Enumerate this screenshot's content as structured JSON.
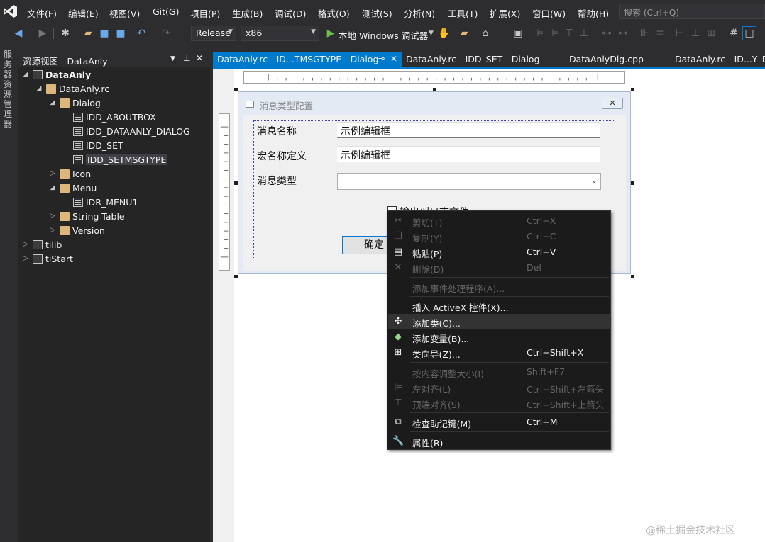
{
  "menubar": {
    "items": [
      "文件(F)",
      "编辑(E)",
      "视图(V)",
      "Git(G)",
      "项目(P)",
      "生成(B)",
      "调试(D)",
      "格式(O)",
      "测试(S)",
      "分析(N)",
      "工具(T)",
      "扩展(X)",
      "窗口(W)",
      "帮助(H)"
    ],
    "search_placeholder": "搜索 (Ctrl+Q)"
  },
  "toolbar": {
    "config": "Release",
    "platform": "x86",
    "run_label": "本地 Windows 调试器"
  },
  "left_strip": {
    "label": "服务器资源管理器"
  },
  "resource_view": {
    "title": "资源视图 - DataAnly",
    "tree": {
      "root": "DataAnly",
      "rc_file": "DataAnly.rc",
      "dialog_folder": "Dialog",
      "dialogs": [
        "IDD_ABOUTBOX",
        "IDD_DATAANLY_DIALOG",
        "IDD_SET",
        "IDD_SETMSGTYPE"
      ],
      "icon_folder": "Icon",
      "menu_folder": "Menu",
      "menu_item": "IDR_MENU1",
      "string_table": "String Table",
      "version": "Version",
      "projects": [
        "tilib",
        "tiStart"
      ]
    }
  },
  "tabs": {
    "active": "DataAnly.rc - ID...TMSGTYPE - Dialog",
    "others": [
      "DataAnly.rc - IDD_SET - Dialog",
      "DataAnlyDlg.cpp",
      "DataAnly.rc - ID...Y_DI"
    ]
  },
  "dialog": {
    "title": "消息类型配置",
    "close_glyph": "✕",
    "labels": [
      "消息名称",
      "宏名称定义",
      "消息类型"
    ],
    "edit_values": [
      "示例编辑框",
      "示例编辑框"
    ],
    "checkbox_label": "输出到日志文件",
    "ok_label": "确定"
  },
  "context_menu": {
    "items": [
      {
        "label": "剪切(T)",
        "shortcut": "Ctrl+X",
        "enabled": false,
        "icon": "cut-icon"
      },
      {
        "label": "复制(Y)",
        "shortcut": "Ctrl+C",
        "enabled": false,
        "icon": "copy-icon"
      },
      {
        "label": "粘贴(P)",
        "shortcut": "Ctrl+V",
        "enabled": true,
        "icon": "paste-icon"
      },
      {
        "label": "删除(D)",
        "shortcut": "Del",
        "enabled": false,
        "icon": "delete-icon"
      },
      {
        "label": "添加事件处理程序(A)...",
        "shortcut": "",
        "enabled": false,
        "icon": ""
      },
      {
        "label": "插入 ActiveX 控件(X)...",
        "shortcut": "",
        "enabled": true,
        "icon": ""
      },
      {
        "label": "添加类(C)...",
        "shortcut": "",
        "enabled": true,
        "icon": "add-class-icon"
      },
      {
        "label": "添加变量(B)...",
        "shortcut": "",
        "enabled": true,
        "icon": "add-variable-icon"
      },
      {
        "label": "类向导(Z)...",
        "shortcut": "Ctrl+Shift+X",
        "enabled": true,
        "icon": "class-wizard-icon"
      },
      {
        "label": "按内容调整大小(I)",
        "shortcut": "Shift+F7",
        "enabled": false,
        "icon": ""
      },
      {
        "label": "左对齐(L)",
        "shortcut": "Ctrl+Shift+左箭头",
        "enabled": false,
        "icon": "align-left-icon"
      },
      {
        "label": "顶端对齐(S)",
        "shortcut": "Ctrl+Shift+上箭头",
        "enabled": false,
        "icon": "align-top-icon"
      },
      {
        "label": "检查助记键(M)",
        "shortcut": "Ctrl+M",
        "enabled": true,
        "icon": "mnemonic-icon"
      },
      {
        "label": "属性(R)",
        "shortcut": "",
        "enabled": true,
        "icon": "wrench-icon"
      }
    ]
  },
  "watermark": "@稀土掘金技术社区"
}
